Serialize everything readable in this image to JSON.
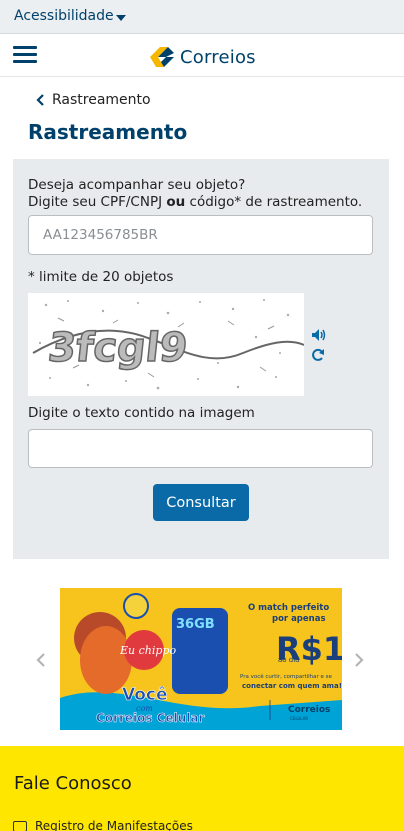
{
  "accessibility": {
    "label": "Acessibilidade"
  },
  "header": {
    "logo_text": "Correios",
    "brand_blue": "#00416b",
    "brand_yellow": "#f5b700"
  },
  "breadcrumb": {
    "label": "Rastreamento"
  },
  "page": {
    "title": "Rastreamento"
  },
  "form": {
    "prompt_line1": "Deseja acompanhar seu objeto?",
    "prompt_line2_a": "Digite seu CPF/CNPJ ",
    "prompt_line2_bold": "ou",
    "prompt_line2_b": " código* de rastreamento.",
    "object_placeholder": "AA123456785BR",
    "limit_text": "* limite de 20 objetos",
    "captcha_text": "3fcgl9",
    "captcha_label": "Digite o texto contido na imagem",
    "submit_label": "Consultar"
  },
  "banner": {
    "headline_line1": "O match perfeito",
    "headline_line2": "por apenas",
    "price": "R$1",
    "price_suffix": "ao dia",
    "gb": "36GB",
    "sticker": "Eu chippo",
    "subtext_line1": "Pra você curtir, compartilhar e se",
    "subtext_line2": "conectar com quem ama!",
    "slogan_line1": "Você",
    "slogan_line2": "com",
    "slogan_line3": "Correios Celular",
    "logo": "Correios",
    "logo_sub": "CELULAR"
  },
  "footer": {
    "title": "Fale Conosco",
    "item_label": "Registro de Manifestações"
  }
}
